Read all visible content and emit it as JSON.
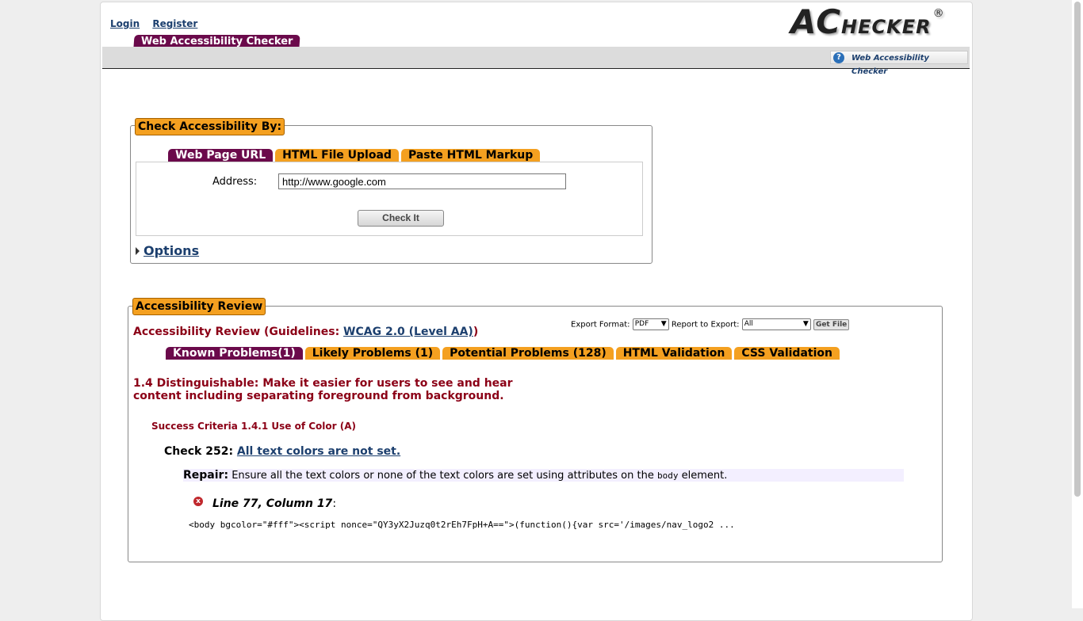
{
  "header": {
    "login": "Login",
    "register": "Register",
    "main_tab": "Web Accessibility Checker",
    "logo_first": "A",
    "logo_c": "C",
    "logo_rest": "HECKER",
    "logo_mark": "®",
    "help_link": "Web Accessibility Checker",
    "help_icon": "?"
  },
  "check_by": {
    "legend": "Check Accessibility By:",
    "tabs": [
      "Web Page URL",
      "HTML File Upload",
      "Paste HTML Markup"
    ],
    "address_label": "Address:",
    "address_value": "http://www.google.com",
    "check_button": "Check It",
    "options": "Options"
  },
  "review": {
    "legend": "Accessibility Review",
    "title_prefix": "Accessibility Review (Guidelines: ",
    "guideline_link": "WCAG 2.0 (Level AA)",
    "title_suffix": ")",
    "export_format_label": "Export Format:",
    "export_format_value": "PDF",
    "report_label": "Report to Export:",
    "report_value": "All",
    "get_file": "Get File",
    "tabs": [
      "Known Problems(1)",
      "Likely Problems (1)",
      "Potential Problems (128)",
      "HTML Validation",
      "CSS Validation"
    ],
    "guideline_heading": "1.4 Distinguishable: Make it easier for users to see and hear content including separating foreground from background.",
    "criteria": "Success Criteria 1.4.1 Use of Color (A)",
    "check_label": "Check 252:",
    "check_link": "All text colors are not set.",
    "repair_label": "Repair:",
    "repair_text_1": "Ensure all the text colors or none of the text colors are set using attributes on the",
    "repair_code": "body",
    "repair_text_2": "element.",
    "error_icon": "x",
    "line_info": "Line 77, Column 17",
    "line_colon": ":",
    "code": "<body bgcolor=\"#fff\"><script nonce=\"QY3yX2Juzq0t2rEh7FpH+A==\">(function(){var src='/images/nav_logo2 ..."
  },
  "colors": {
    "tab_active": "#6b0a4b",
    "tab_inactive": "#f4a020",
    "heading_red": "#8b0016",
    "link": "#1c3f6e"
  }
}
